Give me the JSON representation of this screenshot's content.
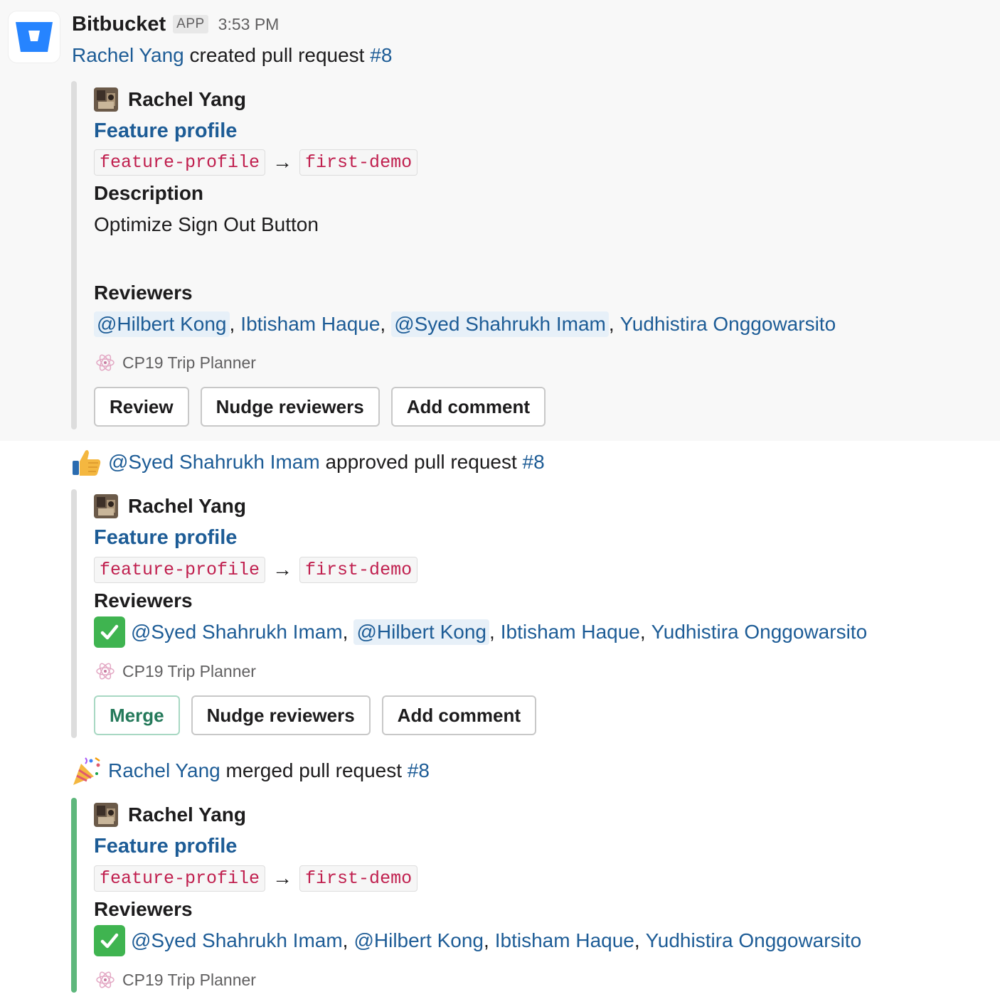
{
  "message": {
    "sender": "Bitbucket",
    "badge": "APP",
    "time": "3:53 PM"
  },
  "events": [
    {
      "actor": "Rachel Yang",
      "action": "created pull request",
      "pr": "#8"
    },
    {
      "icon": "thumbs-up",
      "actor": "@Syed Shahrukh Imam",
      "action": "approved pull request",
      "pr": "#8"
    },
    {
      "icon": "party-popper",
      "actor": "Rachel Yang",
      "action": "merged pull request",
      "pr": "#8"
    }
  ],
  "cards": [
    {
      "author": "Rachel Yang",
      "title": "Feature profile",
      "source_branch": "feature-profile",
      "arrow": "→",
      "target_branch": "first-demo",
      "description_label": "Description",
      "description": "Optimize Sign Out Button",
      "reviewers_label": "Reviewers",
      "reviewers": [
        "@Hilbert Kong",
        "Ibtisham Haque",
        "@Syed Shahrukh Imam",
        "Yudhistira Onggowarsito"
      ],
      "repo": "CP19 Trip Planner",
      "buttons": [
        "Review",
        "Nudge reviewers",
        "Add comment"
      ]
    },
    {
      "author": "Rachel Yang",
      "title": "Feature profile",
      "source_branch": "feature-profile",
      "arrow": "→",
      "target_branch": "first-demo",
      "reviewers_label": "Reviewers",
      "reviewers": [
        "@Syed Shahrukh Imam",
        "@Hilbert Kong",
        "Ibtisham Haque",
        "Yudhistira Onggowarsito"
      ],
      "repo": "CP19 Trip Planner",
      "buttons": [
        "Merge",
        "Nudge reviewers",
        "Add comment"
      ]
    },
    {
      "author": "Rachel Yang",
      "title": "Feature profile",
      "source_branch": "feature-profile",
      "arrow": "→",
      "target_branch": "first-demo",
      "reviewers_label": "Reviewers",
      "reviewers": [
        "@Syed Shahrukh Imam",
        "@Hilbert Kong",
        "Ibtisham Haque",
        "Yudhistira Onggowarsito"
      ],
      "repo": "CP19 Trip Planner"
    }
  ],
  "colors": {
    "link": "#1d5c96",
    "code": "#c01f4e",
    "merged_bar": "#5eb77c",
    "bitbucket": "#2684ff"
  }
}
